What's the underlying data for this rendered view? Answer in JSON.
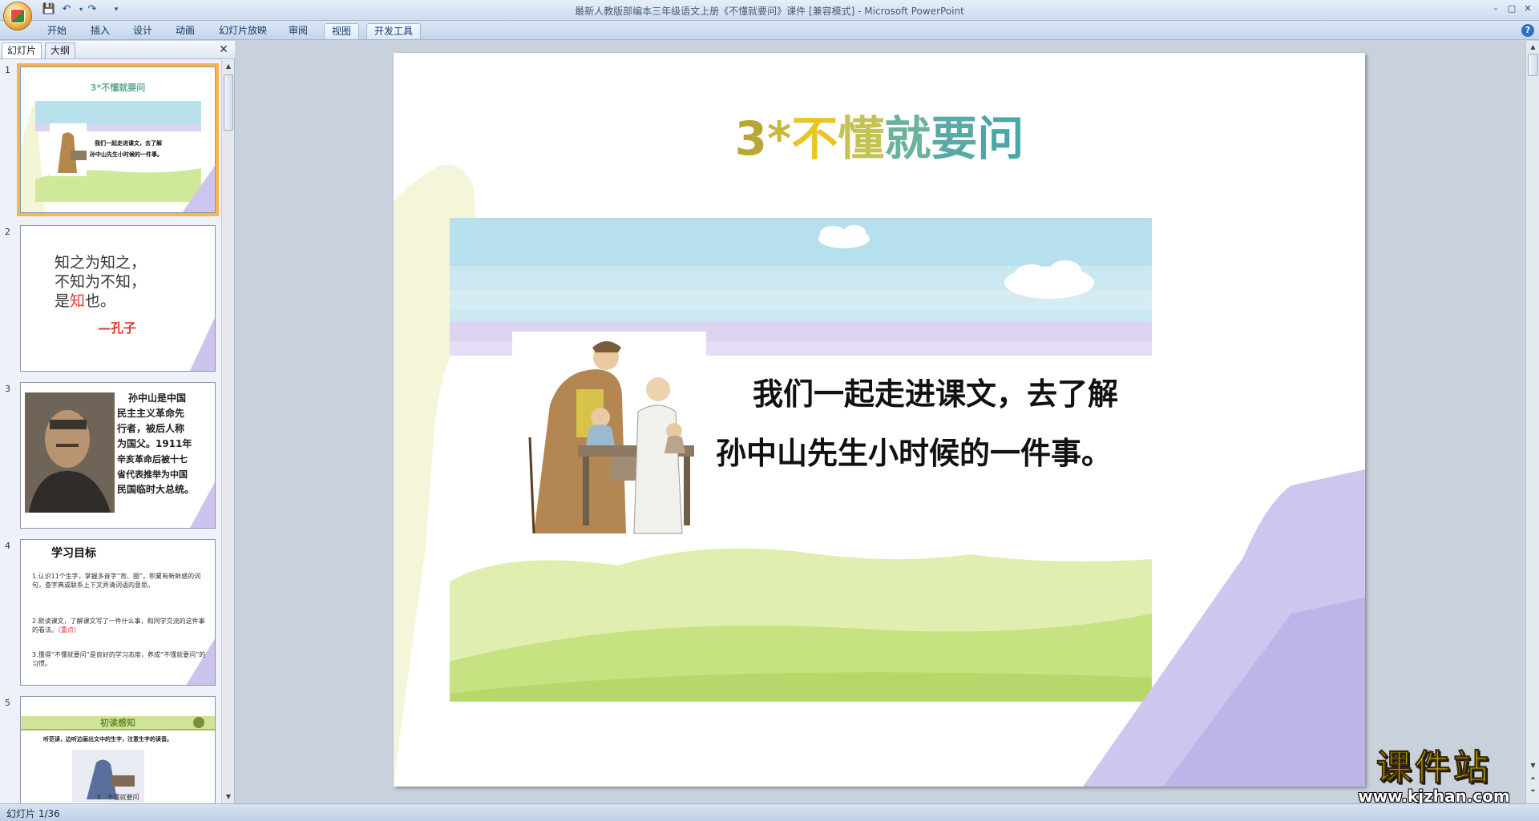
{
  "window": {
    "title": "最新人教版部编本三年级语文上册《不懂就要问》课件 [兼容模式] - Microsoft PowerPoint",
    "controls": [
      "–",
      "□",
      "✕"
    ]
  },
  "ribbon": {
    "tabs": [
      {
        "label": "开始"
      },
      {
        "label": "插入"
      },
      {
        "label": "设计"
      },
      {
        "label": "动画"
      },
      {
        "label": "幻灯片放映"
      },
      {
        "label": "审阅"
      },
      {
        "label": "视图"
      },
      {
        "label": "开发工具"
      }
    ],
    "help": "?"
  },
  "panel": {
    "tabs": [
      "幻灯片",
      "大纲"
    ],
    "close": "✕"
  },
  "thumbs": {
    "t1": {
      "num": "1",
      "title": "3*不懂就要问",
      "text1": "我们一起走进课文，去了解",
      "text2": "孙中山先生小时候的一件事。"
    },
    "t2": {
      "num": "2",
      "l1": "知之为知之，",
      "l2": "不知为不知，",
      "l3a": "是",
      "l3b": "知",
      "l3c": "也。",
      "author": "—孔子"
    },
    "t3": {
      "num": "3",
      "lines": [
        "孙中山是中国",
        "民主主义革命先",
        "行者，被后人称",
        "为国父。1911年",
        "辛亥革命后被十七",
        "省代表推举为中国",
        "民国临时大总统。"
      ]
    },
    "t4": {
      "num": "4",
      "title": "学习目标",
      "p1": "1.认识11个生字，掌握多音字“背、圈”。积累有新鲜感的词句，查字典或联系上下文弄清词语的意思。",
      "p2": "2.默读课文，了解课文写了一件什么事，和同学交流的这件事的看法。",
      "p2key": "（重点）",
      "p3": "3.懂得“不懂就要问”是良好的学习态度，养成“不懂就要问”的习惯。"
    },
    "t5": {
      "num": "5",
      "banner": "初读感知",
      "line": "听范读，边听边画出文中的生字，注意生字的读音。",
      "caption": "3　不懂就要问"
    }
  },
  "slide": {
    "title_parts": [
      "3",
      "*",
      "不",
      "懂",
      "就",
      "要",
      "问"
    ],
    "title_colors": [
      "#b9a637",
      "#c7b93a",
      "#e7c624",
      "#c4c254",
      "#6ab29a",
      "#59a9a7",
      "#4aa7a5"
    ],
    "text_line1": "我们一起走进课文，去了解",
    "text_line2": "孙中山先生小时候的一件事。"
  },
  "status": {
    "slide_info": "幻灯片 1/36"
  },
  "watermark": {
    "title": "课件站",
    "url": "www.kjzhan.com"
  }
}
